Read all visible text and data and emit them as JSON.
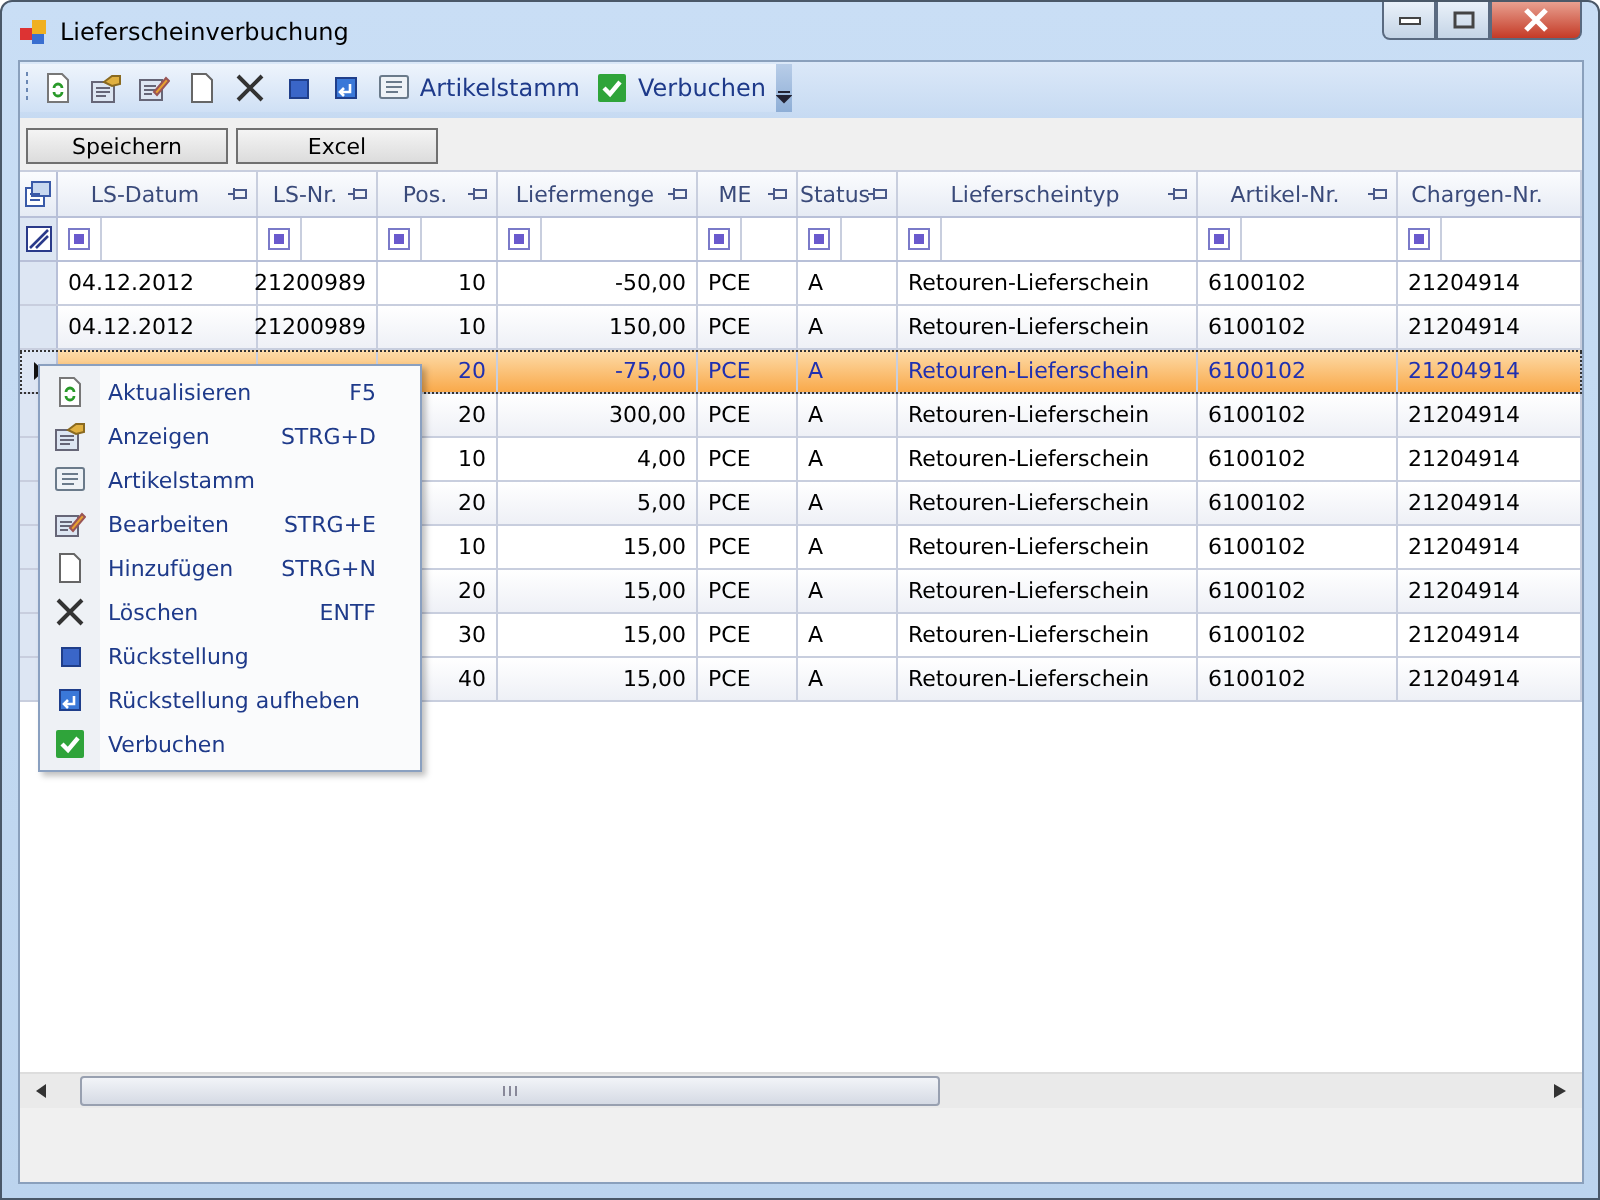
{
  "window": {
    "title": "Lieferscheinverbuchung"
  },
  "toolbar": [
    {
      "kind": "refresh"
    },
    {
      "kind": "display"
    },
    {
      "kind": "edit"
    },
    {
      "kind": "new"
    },
    {
      "kind": "delete"
    },
    {
      "kind": "square"
    },
    {
      "kind": "restore"
    },
    {
      "kind": "list",
      "label": "Artikelstamm"
    },
    {
      "kind": "check",
      "label": "Verbuchen"
    }
  ],
  "buttons": [
    "Speichern",
    "Excel"
  ],
  "table": {
    "columns": [
      "LS-Datum",
      "LS-Nr.",
      "Pos.",
      "Liefermenge",
      "ME",
      "Status",
      "Lieferscheintyp",
      "Artikel-Nr.",
      "Chargen-Nr."
    ],
    "rows": [
      {
        "cells": [
          "04.12.2012",
          "21200989",
          "10",
          "-50,00",
          "PCE",
          "A",
          "Retouren-Lieferschein",
          "6100102",
          "21204914"
        ],
        "selected": false
      },
      {
        "cells": [
          "04.12.2012",
          "21200989",
          "10",
          "150,00",
          "PCE",
          "A",
          "Retouren-Lieferschein",
          "6100102",
          "21204914"
        ],
        "selected": false
      },
      {
        "cells": [
          null,
          null,
          "20",
          "-75,00",
          "PCE",
          "A",
          "Retouren-Lieferschein",
          "6100102",
          "21204914"
        ],
        "selected": true
      },
      {
        "cells": [
          null,
          null,
          "20",
          "300,00",
          "PCE",
          "A",
          "Retouren-Lieferschein",
          "6100102",
          "21204914"
        ],
        "selected": false
      },
      {
        "cells": [
          null,
          null,
          "10",
          "4,00",
          "PCE",
          "A",
          "Retouren-Lieferschein",
          "6100102",
          "21204914"
        ],
        "selected": false
      },
      {
        "cells": [
          null,
          null,
          "20",
          "5,00",
          "PCE",
          "A",
          "Retouren-Lieferschein",
          "6100102",
          "21204914"
        ],
        "selected": false
      },
      {
        "cells": [
          null,
          null,
          "10",
          "15,00",
          "PCE",
          "A",
          "Retouren-Lieferschein",
          "6100102",
          "21204914"
        ],
        "selected": false
      },
      {
        "cells": [
          null,
          null,
          "20",
          "15,00",
          "PCE",
          "A",
          "Retouren-Lieferschein",
          "6100102",
          "21204914"
        ],
        "selected": false
      },
      {
        "cells": [
          null,
          null,
          "30",
          "15,00",
          "PCE",
          "A",
          "Retouren-Lieferschein",
          "6100102",
          "21204914"
        ],
        "selected": false
      },
      {
        "cells": [
          null,
          null,
          "40",
          "15,00",
          "PCE",
          "A",
          "Retouren-Lieferschein",
          "6100102",
          "21204914"
        ],
        "selected": false
      }
    ]
  },
  "context_menu": [
    {
      "kind": "refresh",
      "label": "Aktualisieren",
      "shortcut": "F5"
    },
    {
      "kind": "display",
      "label": "Anzeigen",
      "shortcut": "STRG+D"
    },
    {
      "kind": "list",
      "label": "Artikelstamm"
    },
    {
      "kind": "edit",
      "label": "Bearbeiten",
      "shortcut": "STRG+E"
    },
    {
      "kind": "new",
      "label": "Hinzufügen",
      "shortcut": "STRG+N"
    },
    {
      "kind": "delete",
      "label": "Löschen",
      "shortcut": "ENTF"
    },
    {
      "kind": "square",
      "label": "Rückstellung"
    },
    {
      "kind": "restore",
      "label": "Rückstellung aufheben"
    },
    {
      "kind": "check",
      "label": "Verbuchen"
    }
  ]
}
